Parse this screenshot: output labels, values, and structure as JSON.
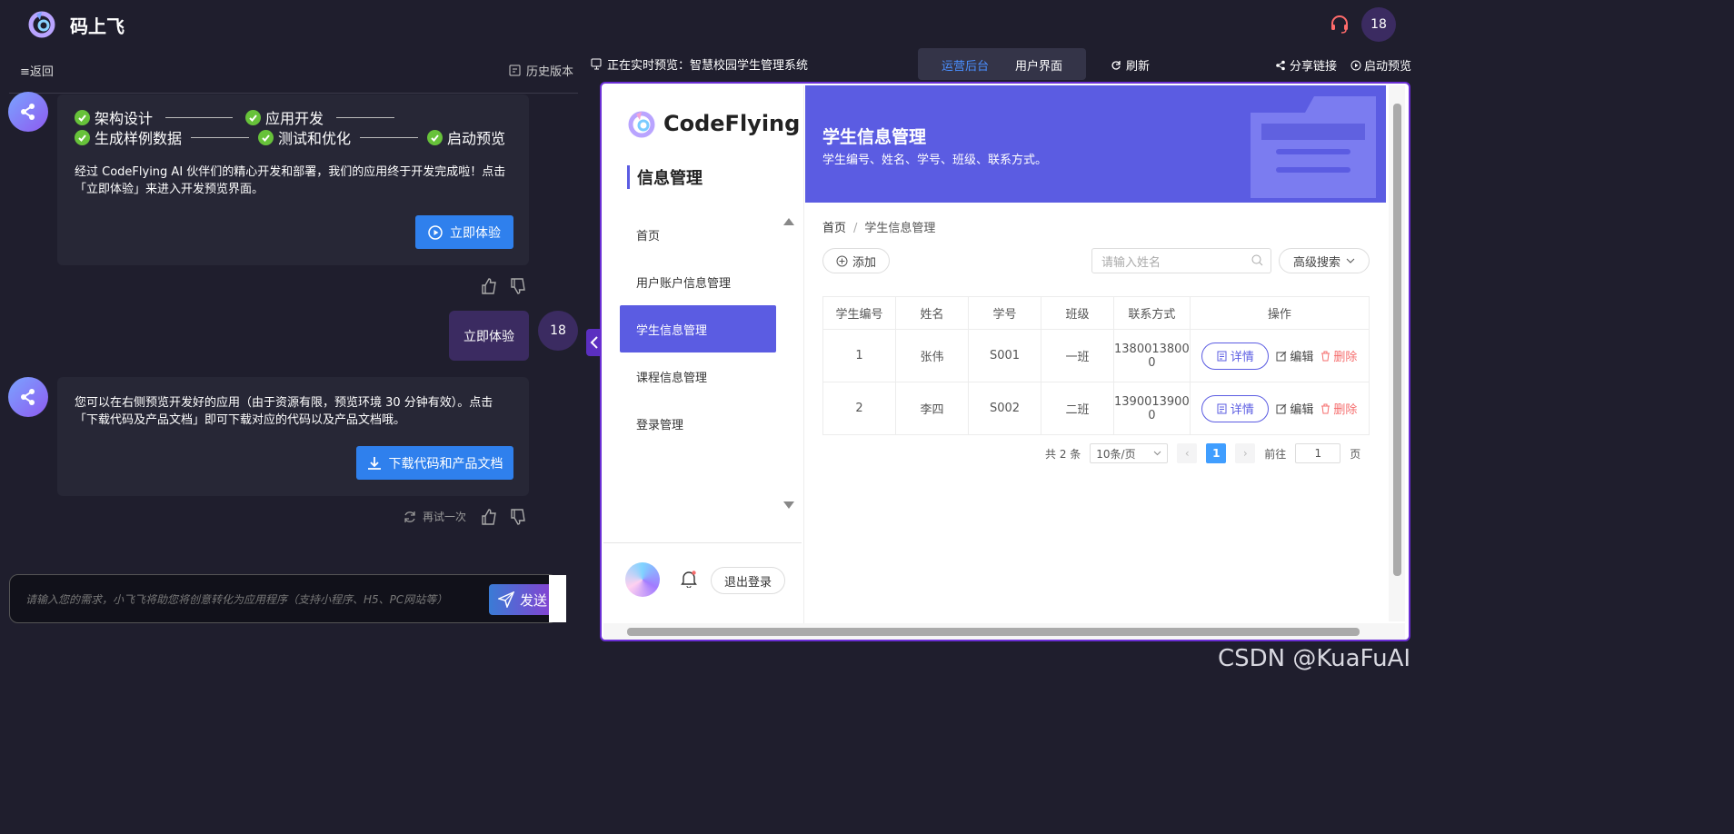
{
  "app": {
    "name": "码上飞",
    "user_badge": "18"
  },
  "left_panel": {
    "back_label": "≡返回",
    "history_label": "历史版本",
    "steps": [
      "架构设计",
      "应用开发",
      "生成样例数据",
      "测试和优化",
      "启动预览"
    ],
    "message1": "经过 CodeFlying AI 伙伴们的精心开发和部署，我们的应用终于开发完成啦！点击「立即体验」来进入开发预览界面。",
    "try_now_button": "立即体验",
    "user_message": "立即体验",
    "user_avatar": "18",
    "message2": "您可以在右侧预览开发好的应用（由于资源有限，预览环境 30 分钟有效）。点击「下载代码及产品文档」即可下载对应的代码以及产品文档哦。",
    "download_button": "下载代码和产品文档",
    "retry_label": "再试一次",
    "composer_placeholder": "请输入您的需求，小飞飞将助您将创意转化为应用程序（支持小程序、H5、PC网站等）",
    "send_label": "发送"
  },
  "preview_toolbar": {
    "live_label": "正在实时预览：智慧校园学生管理系统",
    "tab_admin": "运营后台",
    "tab_user": "用户界面",
    "refresh_label": "刷新",
    "share_label": "分享链接",
    "launch_label": "启动预览"
  },
  "preview_app": {
    "brand": "CodeFlying",
    "section_title": "信息管理",
    "nav": [
      "首页",
      "用户账户信息管理",
      "学生信息管理",
      "课程信息管理",
      "登录管理"
    ],
    "active_nav": 2,
    "logout_label": "退出登录",
    "banner_title": "学生信息管理",
    "banner_subtitle": "学生编号、姓名、学号、班级、联系方式。",
    "breadcrumb": {
      "home": "首页",
      "separator": "/",
      "current": "学生信息管理"
    },
    "add_label": "添加",
    "search_placeholder": "请输入姓名",
    "advanced_search_label": "高级搜索",
    "table": {
      "headers": [
        "学生编号",
        "姓名",
        "学号",
        "班级",
        "联系方式",
        "操作"
      ],
      "rows": [
        {
          "id": "1",
          "name": "张伟",
          "sno": "S001",
          "cls": "一班",
          "phone_l1": "1380013800",
          "phone_l2": "0"
        },
        {
          "id": "2",
          "name": "李四",
          "sno": "S002",
          "cls": "二班",
          "phone_l1": "1390013900",
          "phone_l2": "0"
        }
      ],
      "detail_label": "详情",
      "edit_label": "编辑",
      "delete_label": "删除"
    },
    "pagination": {
      "total": "共 2 条",
      "page_size": "10条/页",
      "current_page": "1",
      "goto_label": "前往",
      "goto_value": "1",
      "page_unit": "页"
    }
  },
  "watermark": "CSDN @KuaFuAI",
  "colors": {
    "bg": "#1f1e2d",
    "accent": "#5b5ce2",
    "blue": "#2f80ed",
    "purple": "#3b2b61",
    "success": "#67c23a",
    "danger": "#f56c6c"
  }
}
